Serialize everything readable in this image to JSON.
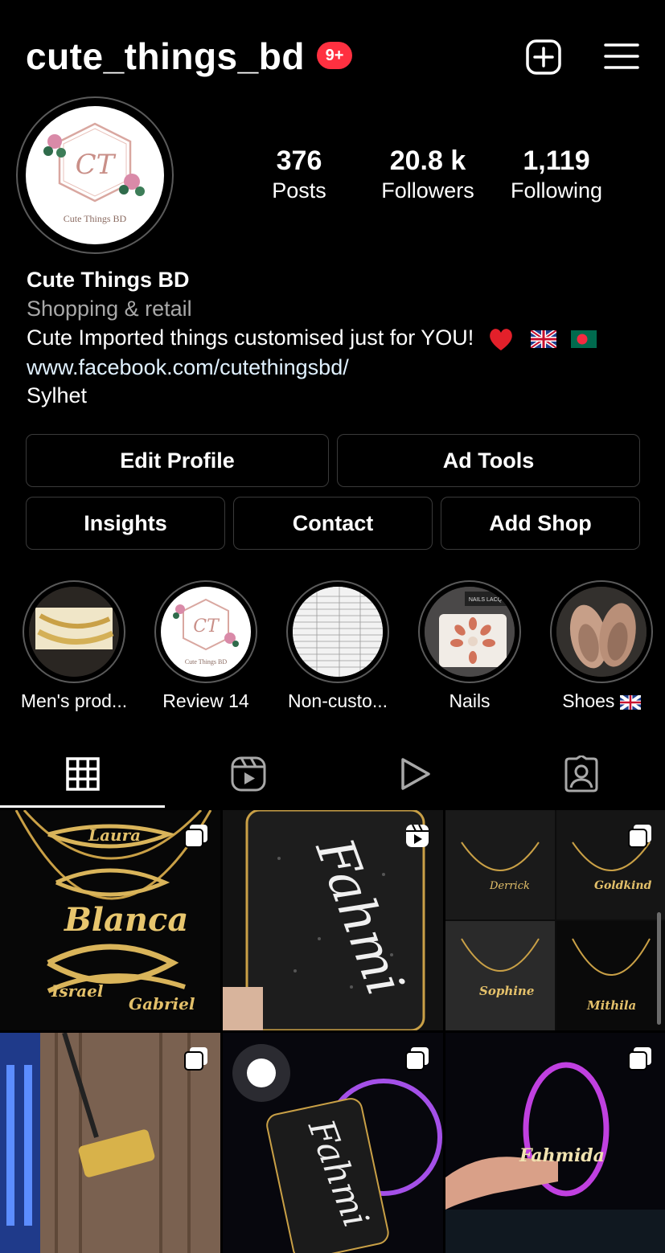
{
  "header": {
    "username": "cute_things_bd",
    "notification_badge": "9+",
    "new_post_icon": "plus-square-icon",
    "menu_icon": "hamburger-menu-icon"
  },
  "profile": {
    "avatar_caption": "Cute Things BD",
    "avatar_monogram": "CT",
    "stats": [
      {
        "value": "376",
        "label": "Posts"
      },
      {
        "value": "20.8 k",
        "label": "Followers"
      },
      {
        "value": "1,119",
        "label": "Following"
      }
    ],
    "name": "Cute Things BD",
    "category": "Shopping & retail",
    "description": "Cute Imported things customised just for YOU!",
    "description_emojis": [
      "red-heart",
      "uk-flag",
      "bangladesh-flag"
    ],
    "website": "www.facebook.com/cutethingsbd/",
    "location": "Sylhet"
  },
  "actions": {
    "edit_profile": "Edit Profile",
    "ad_tools": "Ad Tools",
    "insights": "Insights",
    "contact": "Contact",
    "add_shop": "Add Shop"
  },
  "highlights": [
    {
      "label": "Men's prod..."
    },
    {
      "label": "Review 14"
    },
    {
      "label": "Non-custo..."
    },
    {
      "label": "Nails"
    },
    {
      "label": "Shoes"
    }
  ],
  "highlight_image_text": {
    "review_caption": "Cute Things BD",
    "nails_box": "NAILS LACQU"
  },
  "tabs": [
    {
      "icon": "grid-icon",
      "selected": true
    },
    {
      "icon": "reels-icon",
      "selected": false
    },
    {
      "icon": "play-icon",
      "selected": false
    },
    {
      "icon": "tagged-person-icon",
      "selected": false
    }
  ],
  "posts": [
    {
      "type": "carousel",
      "names": [
        "Laura",
        "Blanca",
        "Israel",
        "Gabriel"
      ]
    },
    {
      "type": "reel",
      "names": [
        "Fahmi"
      ]
    },
    {
      "type": "carousel",
      "names": [
        "Derrick",
        "Goldkind",
        "Sophine",
        "Mithila"
      ]
    },
    {
      "type": "carousel",
      "names": []
    },
    {
      "type": "carousel",
      "names": [
        "Fahmi"
      ]
    },
    {
      "type": "carousel",
      "names": [
        "Fahmida"
      ]
    }
  ],
  "colors": {
    "background": "#000000",
    "badge": "#ff3040",
    "secondary_text": "#a8a8a8",
    "button_border": "#3a3a3a",
    "link": "#e0f1ff"
  }
}
